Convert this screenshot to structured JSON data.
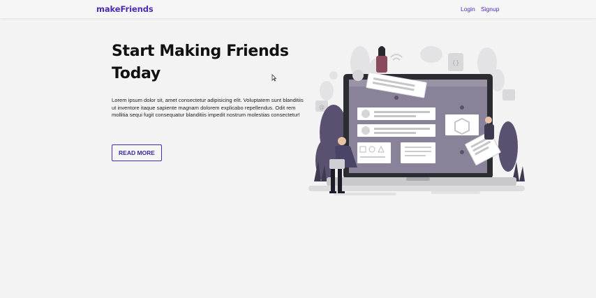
{
  "nav": {
    "brand": "makeFriends",
    "links": [
      {
        "label": "Login"
      },
      {
        "label": "Signup"
      }
    ]
  },
  "hero": {
    "title": "Start Making Friends Today",
    "description": "Lorem ipsum dolor sit, amet consectetur adipisicing elit. Voluptatem sunt blanditiis ut inventore itaque sapiente magnam dolorem explicabo repellendus. Odit rem mollitia sequi fugit consequatur blanditiis impedit nostrum molestias consectetur!",
    "cta_label": "READ MORE"
  },
  "colors": {
    "accent": "#4b2bb5",
    "background": "#f3f3f3",
    "text": "#111111"
  },
  "icons": [
    "mouse-cursor-icon"
  ]
}
